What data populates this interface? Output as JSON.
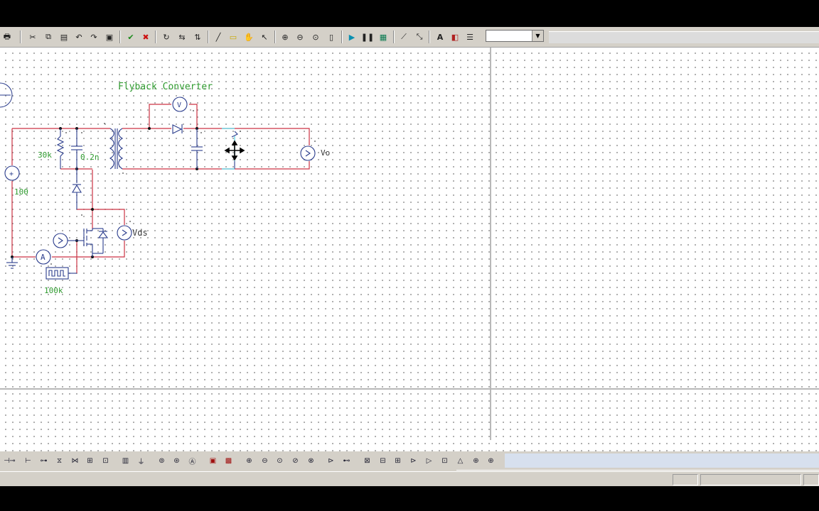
{
  "toolbar": {
    "buttons": [
      "print",
      "cut",
      "copy",
      "paste",
      "undo",
      "redo",
      "clipboard",
      "confirm",
      "cancel",
      "rotate",
      "flip-h",
      "flip-v",
      "wire",
      "label",
      "pan",
      "select",
      "zoom-in",
      "zoom-out",
      "zoom-fit",
      "page",
      "run",
      "pause",
      "scope",
      "line",
      "diag",
      "text",
      "color",
      "props"
    ],
    "zoom_select_value": ""
  },
  "schematic": {
    "title": "Flyback Converter",
    "resistor_value": "30k",
    "capacitor_value": "0.2n",
    "source_value": "100",
    "gate_freq": "100k",
    "probe_vds": "Vds",
    "probe_vo": "Vo",
    "voltmeter_label": "V",
    "ammeter_label": "A",
    "source_symbol": "+"
  },
  "colors": {
    "wire": "#cc3344",
    "component": "#2a3c8c",
    "label": "#2e9a2e",
    "grid": "#9a9a9a"
  },
  "palette": {
    "icons": [
      "R",
      "L",
      "C",
      "D",
      "Z",
      "T",
      "SW",
      "BJT",
      "MOS",
      "IGBT",
      "GND",
      "V",
      "I",
      "A",
      "VS",
      "IS",
      "OSC",
      "PROBE",
      "METER",
      "AMP",
      "CMP",
      "LOGIC",
      "CTL",
      "SUM",
      "GAIN",
      "INT",
      "DIV",
      "LIM",
      "FUNC",
      "PWM",
      "PI",
      "FIL",
      "OUT"
    ]
  },
  "status": {
    "panes": [
      "",
      "",
      ""
    ]
  }
}
